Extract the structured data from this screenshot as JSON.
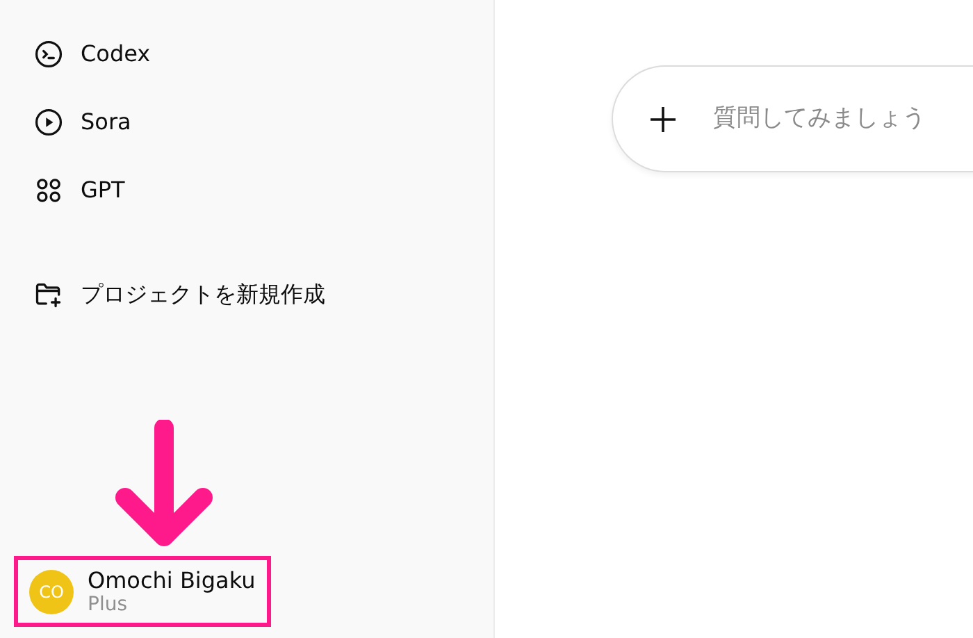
{
  "sidebar": {
    "items": [
      {
        "kind": "codex",
        "label": "Codex"
      },
      {
        "kind": "sora",
        "label": "Sora"
      },
      {
        "kind": "gpt",
        "label": "GPT"
      },
      {
        "kind": "new-project",
        "label": "プロジェクトを新規作成"
      }
    ],
    "user": {
      "initials": "CO",
      "name": "Omochi Bigaku",
      "plan": "Plus",
      "highlighted": true
    }
  },
  "composer": {
    "placeholder": "質問してみましょう"
  }
}
